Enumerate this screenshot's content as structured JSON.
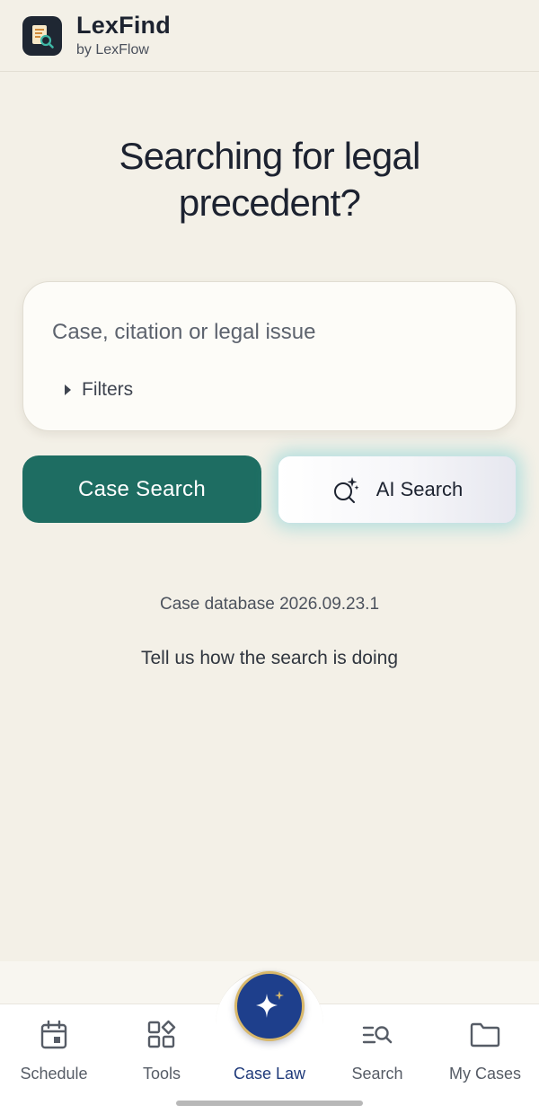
{
  "app": {
    "name": "LexFind",
    "subtitle": "by LexFlow",
    "logo_icon": "document-search-icon"
  },
  "hero": {
    "headline_line1": "Searching for legal",
    "headline_line2": "precedent?"
  },
  "search": {
    "value": "",
    "placeholder": "Case, citation or legal issue",
    "filters_label": "Filters"
  },
  "actions": {
    "case_search_label": "Case Search",
    "ai_search_label": "AI Search",
    "ai_search_icon": "sparkle-search-icon"
  },
  "footer_info": {
    "db_version": "Case database 2026.09.23.1",
    "feedback_link": "Tell us how the search is doing"
  },
  "nav": {
    "items": [
      {
        "label": "Schedule",
        "icon": "calendar-icon"
      },
      {
        "label": "Tools",
        "icon": "tools-grid-icon"
      },
      {
        "label": "Case Law",
        "icon": "sparkle-icon",
        "active": true
      },
      {
        "label": "Search",
        "icon": "list-search-icon"
      },
      {
        "label": "My Cases",
        "icon": "folder-icon"
      }
    ]
  },
  "colors": {
    "background": "#f3f0e7",
    "primary_green": "#1e6d62",
    "active_nav": "#1f3a7a",
    "fab_gold": "#d8b86b",
    "ai_glow": "#6ecdd2"
  }
}
